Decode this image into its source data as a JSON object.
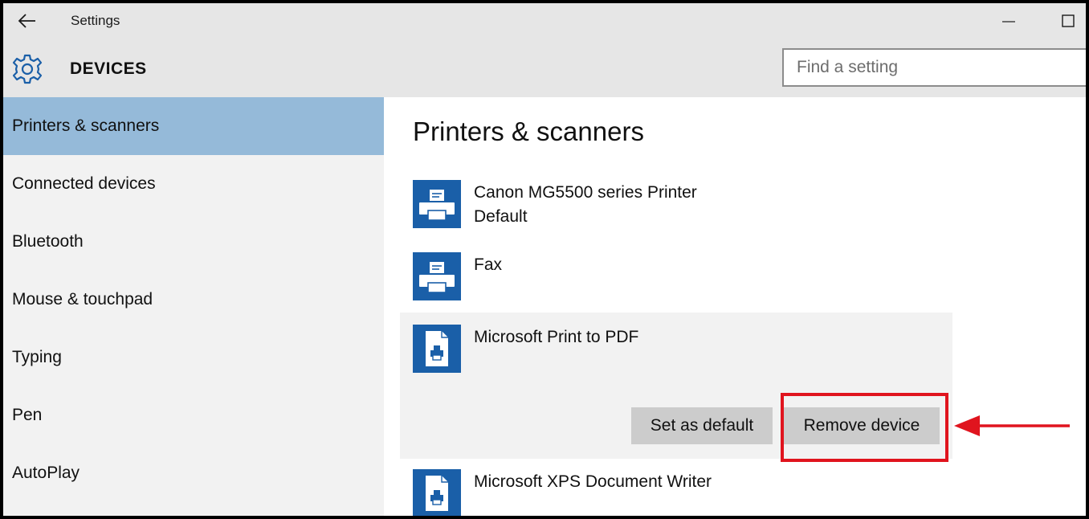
{
  "window": {
    "title": "Settings"
  },
  "header": {
    "section": "DEVICES",
    "search_placeholder": "Find a setting"
  },
  "sidebar": {
    "items": [
      {
        "label": "Printers & scanners",
        "selected": true
      },
      {
        "label": "Connected devices",
        "selected": false
      },
      {
        "label": "Bluetooth",
        "selected": false
      },
      {
        "label": "Mouse & touchpad",
        "selected": false
      },
      {
        "label": "Typing",
        "selected": false
      },
      {
        "label": "Pen",
        "selected": false
      },
      {
        "label": "AutoPlay",
        "selected": false
      }
    ]
  },
  "main": {
    "title": "Printers & scanners",
    "devices": [
      {
        "name": "Canon MG5500 series Printer",
        "status": "Default",
        "icon": "printer-icon"
      },
      {
        "name": "Fax",
        "status": "",
        "icon": "printer-icon"
      },
      {
        "name": "Microsoft Print to PDF",
        "status": "",
        "icon": "document-printer-icon",
        "expanded": true
      },
      {
        "name": "Microsoft XPS Document Writer",
        "status": "",
        "icon": "document-printer-icon"
      }
    ],
    "actions": {
      "set_default": "Set as default",
      "remove": "Remove device"
    }
  },
  "colors": {
    "accent": "#1a5fa8",
    "selected_nav": "#95bad9",
    "annotation": "#e0141e"
  }
}
